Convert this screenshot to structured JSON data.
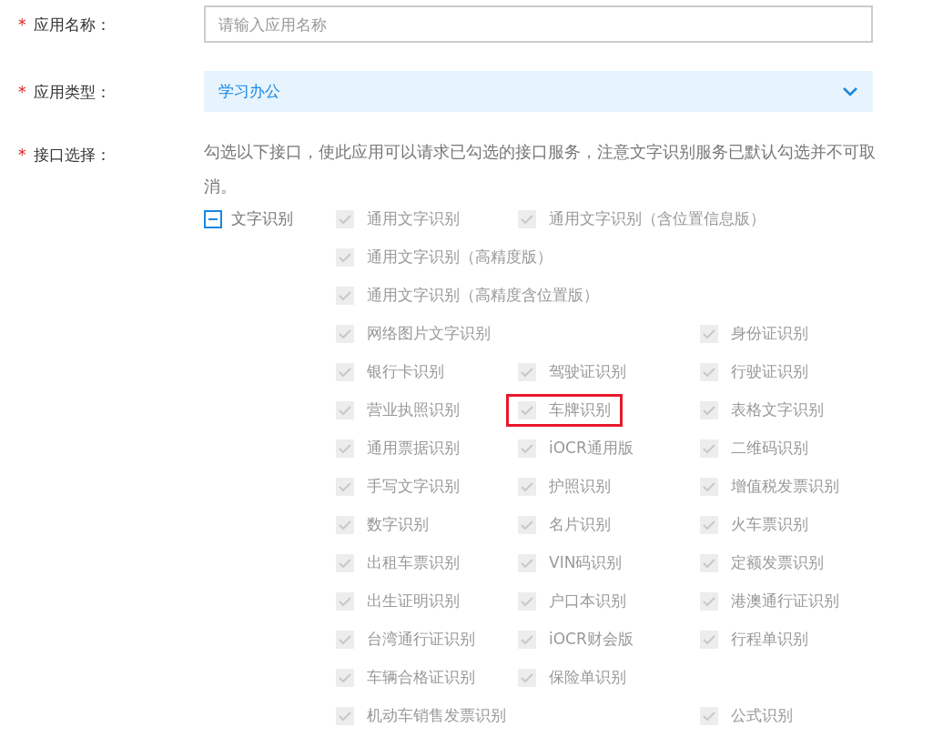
{
  "fields": [
    {
      "kind": "input",
      "label": "应用名称：",
      "required_mark": "*",
      "placeholder": "请输入应用名称"
    },
    {
      "kind": "select",
      "label": "应用类型：",
      "required_mark": "*",
      "value": "学习办公"
    }
  ],
  "api_section": {
    "label": "接口选择：",
    "required_mark": "*",
    "description": "勾选以下接口，使此应用可以请求已勾选的接口服务，注意文字识别服务已默认勾选并不可取消。",
    "group": {
      "label": "文字识别",
      "expanded": true,
      "rows": [
        [
          {
            "kind": "option",
            "label": "通用文字识别",
            "checked": true,
            "disabled": true,
            "highlighted": false
          },
          {
            "kind": "option",
            "label": "通用文字识别（含位置信息版）",
            "checked": true,
            "disabled": true,
            "highlighted": false
          }
        ],
        [
          {
            "kind": "option",
            "label": "通用文字识别（高精度版）",
            "checked": true,
            "disabled": true,
            "highlighted": false
          }
        ],
        [
          {
            "kind": "option",
            "label": "通用文字识别（高精度含位置版）",
            "checked": true,
            "disabled": true,
            "highlighted": false
          }
        ],
        [
          {
            "kind": "option",
            "label": "网络图片文字识别",
            "checked": true,
            "disabled": true,
            "highlighted": false
          },
          {
            "kind": "empty"
          },
          {
            "kind": "option",
            "label": "身份证识别",
            "checked": true,
            "disabled": true,
            "highlighted": false
          }
        ],
        [
          {
            "kind": "option",
            "label": "银行卡识别",
            "checked": true,
            "disabled": true,
            "highlighted": false
          },
          {
            "kind": "option",
            "label": "驾驶证识别",
            "checked": true,
            "disabled": true,
            "highlighted": false
          },
          {
            "kind": "option",
            "label": "行驶证识别",
            "checked": true,
            "disabled": true,
            "highlighted": false
          }
        ],
        [
          {
            "kind": "option",
            "label": "营业执照识别",
            "checked": true,
            "disabled": true,
            "highlighted": false
          },
          {
            "kind": "option",
            "label": "车牌识别",
            "checked": true,
            "disabled": true,
            "highlighted": true
          },
          {
            "kind": "option",
            "label": "表格文字识别",
            "checked": true,
            "disabled": true,
            "highlighted": false
          }
        ],
        [
          {
            "kind": "option",
            "label": "通用票据识别",
            "checked": true,
            "disabled": true,
            "highlighted": false
          },
          {
            "kind": "option",
            "label": "iOCR通用版",
            "checked": true,
            "disabled": true,
            "highlighted": false
          },
          {
            "kind": "option",
            "label": "二维码识别",
            "checked": true,
            "disabled": true,
            "highlighted": false
          }
        ],
        [
          {
            "kind": "option",
            "label": "手写文字识别",
            "checked": true,
            "disabled": true,
            "highlighted": false
          },
          {
            "kind": "option",
            "label": "护照识别",
            "checked": true,
            "disabled": true,
            "highlighted": false
          },
          {
            "kind": "option",
            "label": "增值税发票识别",
            "checked": true,
            "disabled": true,
            "highlighted": false
          }
        ],
        [
          {
            "kind": "option",
            "label": "数字识别",
            "checked": true,
            "disabled": true,
            "highlighted": false
          },
          {
            "kind": "option",
            "label": "名片识别",
            "checked": true,
            "disabled": true,
            "highlighted": false
          },
          {
            "kind": "option",
            "label": "火车票识别",
            "checked": true,
            "disabled": true,
            "highlighted": false
          }
        ],
        [
          {
            "kind": "option",
            "label": "出租车票识别",
            "checked": true,
            "disabled": true,
            "highlighted": false
          },
          {
            "kind": "option",
            "label": "VIN码识别",
            "checked": true,
            "disabled": true,
            "highlighted": false
          },
          {
            "kind": "option",
            "label": "定额发票识别",
            "checked": true,
            "disabled": true,
            "highlighted": false
          }
        ],
        [
          {
            "kind": "option",
            "label": "出生证明识别",
            "checked": true,
            "disabled": true,
            "highlighted": false
          },
          {
            "kind": "option",
            "label": "户口本识别",
            "checked": true,
            "disabled": true,
            "highlighted": false
          },
          {
            "kind": "option",
            "label": "港澳通行证识别",
            "checked": true,
            "disabled": true,
            "highlighted": false
          }
        ],
        [
          {
            "kind": "option",
            "label": "台湾通行证识别",
            "checked": true,
            "disabled": true,
            "highlighted": false
          },
          {
            "kind": "option",
            "label": "iOCR财会版",
            "checked": true,
            "disabled": true,
            "highlighted": false
          },
          {
            "kind": "option",
            "label": "行程单识别",
            "checked": true,
            "disabled": true,
            "highlighted": false
          }
        ],
        [
          {
            "kind": "option",
            "label": "车辆合格证识别",
            "checked": true,
            "disabled": true,
            "highlighted": false
          },
          {
            "kind": "option",
            "label": "保险单识别",
            "checked": true,
            "disabled": true,
            "highlighted": false
          }
        ],
        [
          {
            "kind": "option",
            "label": "机动车销售发票识别",
            "checked": true,
            "disabled": true,
            "highlighted": false
          },
          {
            "kind": "empty"
          },
          {
            "kind": "option",
            "label": "公式识别",
            "checked": true,
            "disabled": true,
            "highlighted": false
          }
        ]
      ]
    }
  }
}
